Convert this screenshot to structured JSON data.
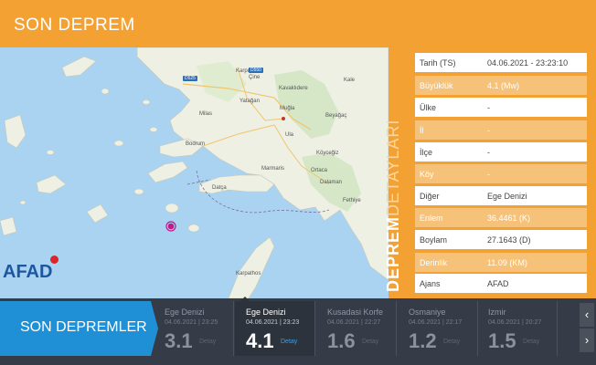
{
  "header": {
    "title": "SON DEPREM"
  },
  "map": {
    "labels": {
      "karpuzlu": "Karpuzlu",
      "cine": "Çine",
      "kavaklidere": "Kavaklıdere",
      "yatagan": "Yatağan",
      "kale": "Kale",
      "mugla": "Muğla",
      "milas": "Milas",
      "bodrum": "Bodrum",
      "ula": "Ula",
      "koycegiz": "Köyceğiz",
      "marmaris": "Marmaris",
      "ortaca": "Ortaca",
      "datca": "Datça",
      "dalaman": "Dalaman",
      "fethiye": "Fethiye",
      "beyagac": "Beyağaç",
      "karpathos": "Karpathos"
    },
    "road_badges": {
      "d525": "D525",
      "d550": "D550"
    },
    "logo": "AFAD"
  },
  "details": {
    "vertical_title_1": "DEPREM",
    "vertical_title_2": "DETAYLARI",
    "rows": [
      {
        "label": "Tarih (TS)",
        "value": "04.06.2021 - 23:23:10"
      },
      {
        "label": "Büyüklük",
        "value": "4.1 (Mw)"
      },
      {
        "label": "Ülke",
        "value": "-"
      },
      {
        "label": "İl",
        "value": "-"
      },
      {
        "label": "İlçe",
        "value": "-"
      },
      {
        "label": "Köy",
        "value": "-"
      },
      {
        "label": "Diğer",
        "value": "Ege Denizi"
      },
      {
        "label": "Enlem",
        "value": "36.4461 (K)"
      },
      {
        "label": "Boylam",
        "value": "27.1643 (D)"
      },
      {
        "label": "Derinlik",
        "value": "11.09 (KM)"
      },
      {
        "label": "Ajans",
        "value": "AFAD"
      }
    ]
  },
  "bottom": {
    "tab_label": "SON DEPREMLER",
    "quakes": [
      {
        "place": "Ege Denizi",
        "date": "04.06.2021 | 23:25",
        "magnitude": "3.1",
        "link": "Detay"
      },
      {
        "place": "Ege Denizi",
        "date": "04.06.2021 | 23:23",
        "magnitude": "4.1",
        "link": "Detay"
      },
      {
        "place": "Kusadasi Korfe",
        "date": "04.06.2021 | 22:27",
        "magnitude": "1.6",
        "link": "Detay"
      },
      {
        "place": "Osmaniye",
        "date": "04.06.2021 | 22:17",
        "magnitude": "1.2",
        "link": "Detay"
      },
      {
        "place": "Izmir",
        "date": "04.06.2021 | 20:27",
        "magnitude": "1.5",
        "link": "Detay"
      }
    ],
    "prev_icon": "‹",
    "next_icon": "›"
  },
  "colors": {
    "orange": "#f4a133",
    "blue": "#1f8fd6",
    "dark": "#353c47",
    "sea": "#a9d3f0",
    "land": "#eef0e4",
    "epicenter": "#c2188a"
  }
}
